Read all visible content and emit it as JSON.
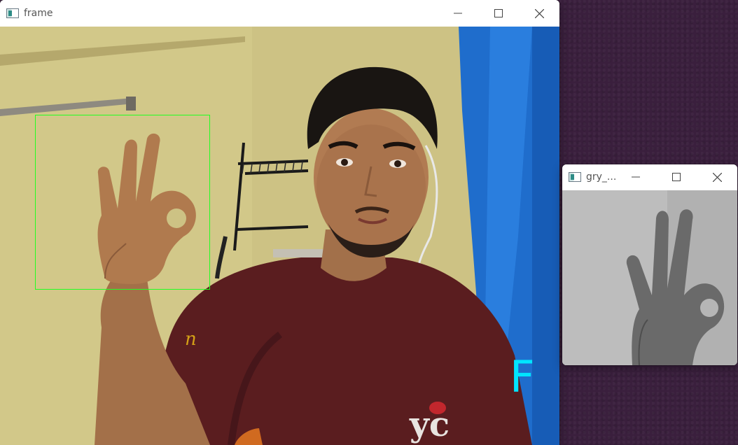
{
  "windows": {
    "frame": {
      "title": "frame",
      "prediction": "F",
      "roi_color": "#22ff22",
      "prediction_color": "#00e5ff",
      "shirt_logo": "yc",
      "shirt_print": "n"
    },
    "gray": {
      "title": "gry_..."
    }
  },
  "controls": {
    "minimize_icon": "minimize-icon",
    "maximize_icon": "maximize-icon",
    "close_icon": "close-icon"
  },
  "colors": {
    "desktop": "#3a1f3d",
    "curtain": "#1e6fd0",
    "shirt": "#5a1d1f"
  }
}
